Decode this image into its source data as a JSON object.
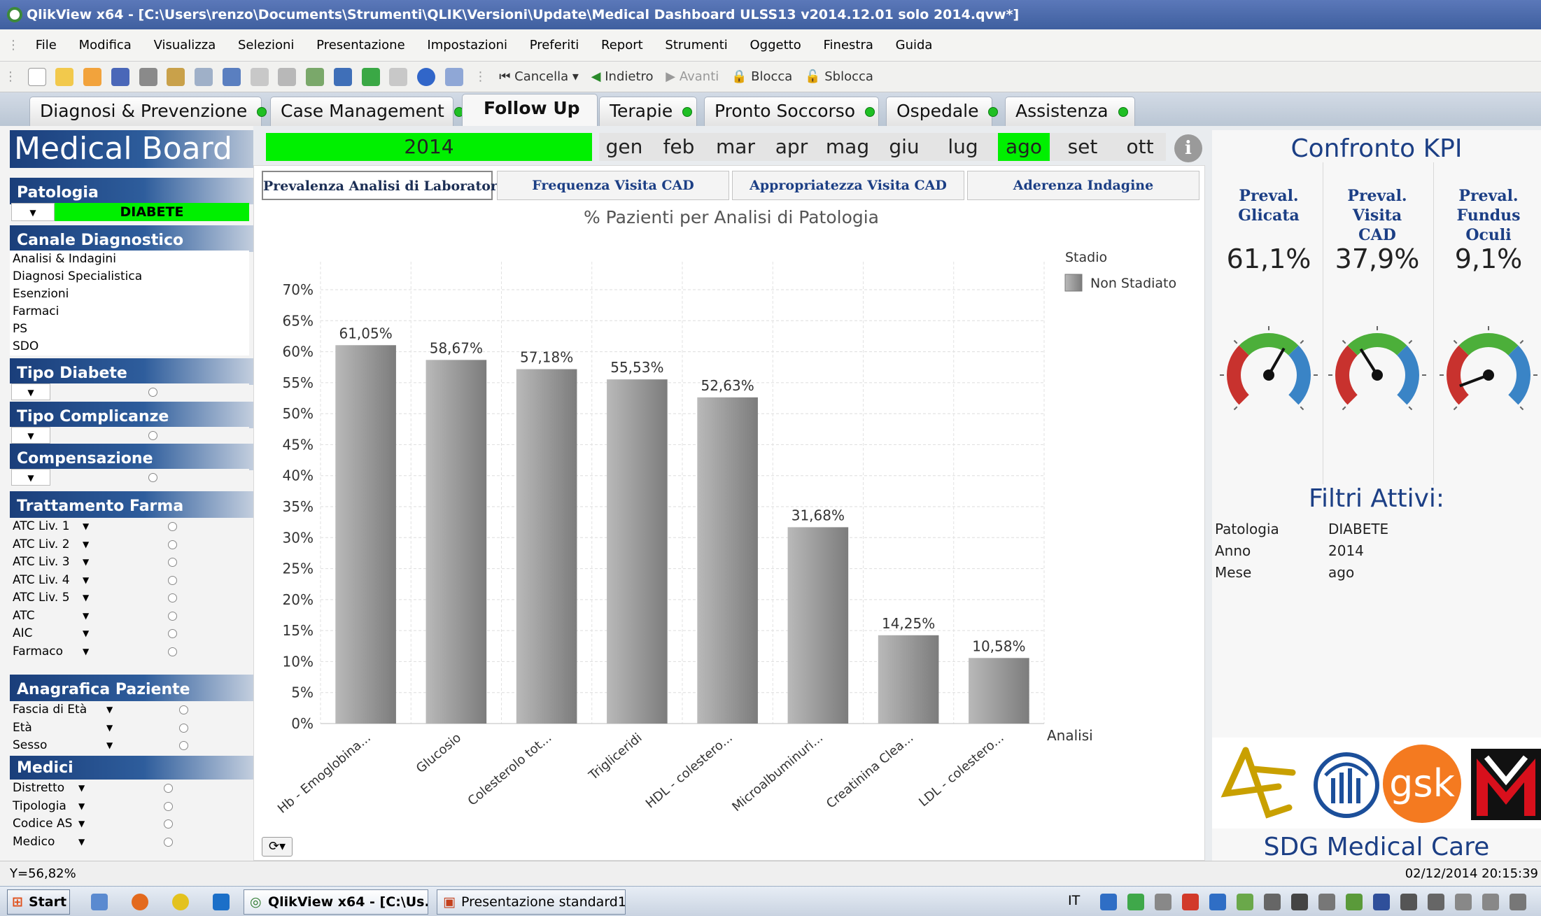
{
  "window": {
    "title": "QlikView x64 - [C:\\Users\\renzo\\Documents\\Strumenti\\QLIK\\Versioni\\Update\\Medical Dashboard ULSS13 v2014.12.01 solo 2014.qvw*]"
  },
  "menu": [
    "File",
    "Modifica",
    "Visualizza",
    "Selezioni",
    "Presentazione",
    "Impostazioni",
    "Preferiti",
    "Report",
    "Strumenti",
    "Oggetto",
    "Finestra",
    "Guida"
  ],
  "toolbar": {
    "cancel": "Cancella",
    "back": "Indietro",
    "forward": "Avanti",
    "lock": "Blocca",
    "unlock": "Sblocca"
  },
  "tabs": [
    "Diagnosi & Prevenzione",
    "Case Management",
    "Follow Up",
    "Terapie",
    "Pronto Soccorso",
    "Ospedale",
    "Assistenza"
  ],
  "active_tab": "Follow Up",
  "sidebar": {
    "title": "Medical Board",
    "patologia": {
      "header": "Patologia",
      "value": "DIABETE"
    },
    "canale": {
      "header": "Canale Diagnostico",
      "items": [
        "Analisi & Indagini",
        "Diagnosi Specialistica",
        "Esenzioni",
        "Farmaci",
        "PS",
        "SDO"
      ]
    },
    "tipo_diabete": "Tipo Diabete",
    "tipo_complicanze": "Tipo Complicanze",
    "compensazione": "Compensazione",
    "trattamento": {
      "header": "Trattamento Farma",
      "items": [
        "ATC Liv. 1",
        "ATC Liv. 2",
        "ATC Liv. 3",
        "ATC Liv. 4",
        "ATC Liv. 5",
        "ATC",
        "AIC",
        "Farmaco"
      ]
    },
    "anagrafica": {
      "header": "Anagrafica Paziente",
      "items": [
        "Fascia di Età",
        "Età",
        "Sesso"
      ]
    },
    "medici": {
      "header": "Medici",
      "items": [
        "Distretto",
        "Tipologia",
        "Codice AS",
        "Medico"
      ]
    }
  },
  "year": "2014",
  "months": [
    "gen",
    "feb",
    "mar",
    "apr",
    "mag",
    "giu",
    "lug",
    "ago",
    "set",
    "ott"
  ],
  "selected_month": "ago",
  "subtabs": [
    "Prevalenza Analisi di Laboratorio",
    "Frequenza Visita CAD",
    "Appropriatezza Visita CAD",
    "Aderenza Indagine"
  ],
  "chart_data": {
    "type": "bar",
    "title": "% Pazienti per Analisi di Patologia",
    "xlabel": "Analisi",
    "ylabel": "",
    "categories": [
      "Hb - Emoglobina...",
      "Glucosio",
      "Colesterolo tot...",
      "Trigliceridi",
      "HDL - colestero...",
      "Microalbuminuri...",
      "Creatinina Clea...",
      "LDL - colestero..."
    ],
    "series": [
      {
        "name": "Non Stadiato",
        "values": [
          61.05,
          58.67,
          57.18,
          55.53,
          52.63,
          31.68,
          14.25,
          10.58
        ]
      }
    ],
    "value_labels": [
      "61,05%",
      "58,67%",
      "57,18%",
      "55,53%",
      "52,63%",
      "31,68%",
      "14,25%",
      "10,58%"
    ],
    "yticks": [
      "0%",
      "5%",
      "10%",
      "15%",
      "20%",
      "25%",
      "30%",
      "35%",
      "40%",
      "45%",
      "50%",
      "55%",
      "60%",
      "65%",
      "70%"
    ],
    "ylim": [
      0,
      70
    ],
    "legend_title": "Stadio",
    "legend_position": "top-right",
    "grid": true
  },
  "kpi": {
    "title": "Confronto KPI",
    "items": [
      {
        "label1": "Preval.",
        "label2": "Glicata",
        "value": "61,1%",
        "needle_fraction": 0.61
      },
      {
        "label1": "Preval. Visita",
        "label2": "CAD",
        "value": "37,9%",
        "needle_fraction": 0.38
      },
      {
        "label1": "Preval.",
        "label2": "Fundus Oculi",
        "value": "9,1%",
        "needle_fraction": 0.09
      }
    ]
  },
  "filters": {
    "title": "Filtri Attivi:",
    "rows": [
      {
        "k": "Patologia",
        "v": "DIABETE"
      },
      {
        "k": "Anno",
        "v": "2014"
      },
      {
        "k": "Mese",
        "v": "ago"
      }
    ]
  },
  "brand": "SDG Medical Care",
  "logo_text": "gsk",
  "status": {
    "left": "Y=56,82%",
    "right": "02/12/2014 20:15:39"
  },
  "taskbar": {
    "start": "Start",
    "tasks": [
      "QlikView x64 - [C:\\Us...",
      "Presentazione standard1..."
    ],
    "lang": "IT"
  },
  "colors": {
    "selected": "#00f000",
    "header_blue": "#1c3f85",
    "bar": "#8c8c8c"
  }
}
